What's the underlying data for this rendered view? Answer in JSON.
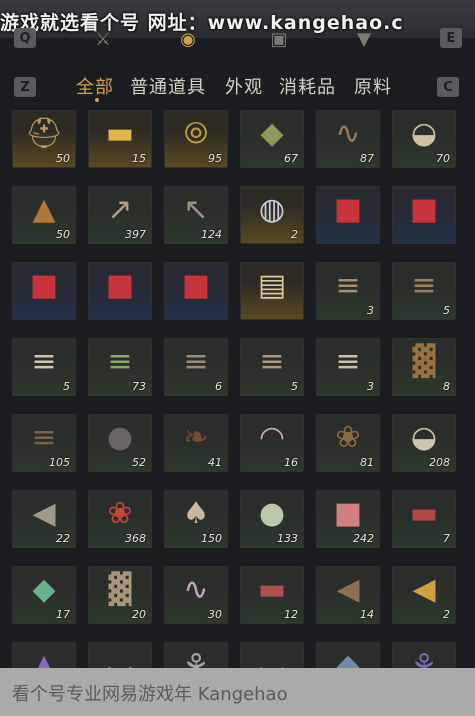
{
  "watermark": {
    "top": "游戏就选看个号   网址：www.kangehao.c",
    "bottom": "看个号专业网易游戏年 Kangehao"
  },
  "keys": {
    "q": "Q",
    "e": "E",
    "z": "Z",
    "c": "C"
  },
  "top_icons": [
    {
      "name": "crossed-swords-icon",
      "glyph": "⚔",
      "active": false
    },
    {
      "name": "pouch-icon",
      "glyph": "◉",
      "active": true
    },
    {
      "name": "box-icon",
      "glyph": "▣",
      "active": false
    },
    {
      "name": "chevrons-down-icon",
      "glyph": "▼",
      "active": false
    }
  ],
  "tabs": [
    {
      "label": "全部",
      "active": true
    },
    {
      "label": "普通道具",
      "active": false
    },
    {
      "label": "外观",
      "active": false
    },
    {
      "label": "消耗品",
      "active": false
    },
    {
      "label": "原料",
      "active": false
    }
  ],
  "items": [
    {
      "name": "helmet-item",
      "icon": "⛑",
      "qty": "50",
      "bg": "gold",
      "color": "#b89a5a"
    },
    {
      "name": "gold-ingot-item",
      "icon": "▬",
      "qty": "15",
      "bg": "gold",
      "color": "#e0b54a"
    },
    {
      "name": "coin-item",
      "icon": "⦾",
      "qty": "95",
      "bg": "gold",
      "color": "#c59a3c"
    },
    {
      "name": "herb-powder-item",
      "icon": "◆",
      "qty": "67",
      "bg": "green",
      "color": "#8a9c5a"
    },
    {
      "name": "worm-item",
      "icon": "∿",
      "qty": "87",
      "bg": "green",
      "color": "#9a7a5a"
    },
    {
      "name": "sack-item",
      "icon": "◒",
      "qty": "70",
      "bg": "green",
      "color": "#cfc2a4"
    },
    {
      "name": "spice-pile-item",
      "icon": "▲",
      "qty": "50",
      "bg": "green",
      "color": "#b0783c"
    },
    {
      "name": "arrows-item",
      "icon": "↗",
      "qty": "397",
      "bg": "green",
      "color": "#b0a08a"
    },
    {
      "name": "arrow-bundle-item",
      "icon": "↖",
      "qty": "124",
      "bg": "green",
      "color": "#a0907a"
    },
    {
      "name": "pearl-ball-item",
      "icon": "◍",
      "qty": "2",
      "bg": "gold",
      "color": "#c8cde0"
    },
    {
      "name": "red-envelope-item",
      "icon": "■",
      "qty": "",
      "bg": "blue",
      "color": "#c8343c"
    },
    {
      "name": "red-envelope-item",
      "icon": "■",
      "qty": "",
      "bg": "blue",
      "color": "#c8343c"
    },
    {
      "name": "red-envelope-item",
      "icon": "■",
      "qty": "",
      "bg": "blue",
      "color": "#c8343c"
    },
    {
      "name": "red-envelope-item",
      "icon": "■",
      "qty": "",
      "bg": "blue",
      "color": "#c8343c"
    },
    {
      "name": "red-envelope-item",
      "icon": "■",
      "qty": "",
      "bg": "blue",
      "color": "#c8343c"
    },
    {
      "name": "scroll-item",
      "icon": "▤",
      "qty": "",
      "bg": "gold",
      "color": "#d8c9a0"
    },
    {
      "name": "logs-item",
      "icon": "≡",
      "qty": "3",
      "bg": "green",
      "color": "#a89070"
    },
    {
      "name": "logs-item",
      "icon": "≡",
      "qty": "5",
      "bg": "green",
      "color": "#a0825a"
    },
    {
      "name": "birch-logs-item",
      "icon": "≡",
      "qty": "5",
      "bg": "green",
      "color": "#cfc4ae"
    },
    {
      "name": "bamboo-item",
      "icon": "≡",
      "qty": "73",
      "bg": "green",
      "color": "#8aa66a"
    },
    {
      "name": "logs-item",
      "icon": "≡",
      "qty": "6",
      "bg": "green",
      "color": "#9a8c78"
    },
    {
      "name": "logs-item",
      "icon": "≡",
      "qty": "5",
      "bg": "green",
      "color": "#b09a7c"
    },
    {
      "name": "birch-logs-item",
      "icon": "≡",
      "qty": "3",
      "bg": "green",
      "color": "#c9c0ae"
    },
    {
      "name": "fur-item",
      "icon": "▓",
      "qty": "8",
      "bg": "green",
      "color": "#9a7040"
    },
    {
      "name": "firewood-item",
      "icon": "≡",
      "qty": "105",
      "bg": "green",
      "color": "#7a6450"
    },
    {
      "name": "stone-item",
      "icon": "●",
      "qty": "52",
      "bg": "green",
      "color": "#6a6562"
    },
    {
      "name": "feather-item",
      "icon": "❧",
      "qty": "41",
      "bg": "green",
      "color": "#7a4a36"
    },
    {
      "name": "shells-item",
      "icon": "◠",
      "qty": "16",
      "bg": "green",
      "color": "#c8b49a"
    },
    {
      "name": "shrimp-item",
      "icon": "❀",
      "qty": "81",
      "bg": "green",
      "color": "#8a6a40"
    },
    {
      "name": "rice-sack-item",
      "icon": "◒",
      "qty": "208",
      "bg": "green",
      "color": "#cfc4ae"
    },
    {
      "name": "fish-item",
      "icon": "◀",
      "qty": "22",
      "bg": "green",
      "color": "#a09a8a"
    },
    {
      "name": "berries-item",
      "icon": "❀",
      "qty": "368",
      "bg": "green",
      "color": "#c04a38"
    },
    {
      "name": "mushrooms-item",
      "icon": "♠",
      "qty": "150",
      "bg": "green",
      "color": "#c8b8a0"
    },
    {
      "name": "eggs-item",
      "icon": "●",
      "qty": "133",
      "bg": "green",
      "color": "#b8c8a8"
    },
    {
      "name": "meat-chunks-item",
      "icon": "■",
      "qty": "242",
      "bg": "green",
      "color": "#d08080"
    },
    {
      "name": "steak-item",
      "icon": "▬",
      "qty": "7",
      "bg": "green",
      "color": "#b04848"
    },
    {
      "name": "jade-stone-item",
      "icon": "◆",
      "qty": "17",
      "bg": "green",
      "color": "#6ab08a"
    },
    {
      "name": "hide-item",
      "icon": "▓",
      "qty": "20",
      "bg": "green",
      "color": "#a8947a"
    },
    {
      "name": "tentacle-item",
      "icon": "∿",
      "qty": "30",
      "bg": "green",
      "color": "#c8a8c0"
    },
    {
      "name": "raw-meat-item",
      "icon": "▬",
      "qty": "12",
      "bg": "green",
      "color": "#b05050"
    },
    {
      "name": "catfish-item",
      "icon": "◀",
      "qty": "14",
      "bg": "green",
      "color": "#8a7050"
    },
    {
      "name": "goldfish-item",
      "icon": "◀",
      "qty": "2",
      "bg": "green",
      "color": "#d0a040"
    },
    {
      "name": "crystal-item",
      "icon": "▲",
      "qty": "",
      "bg": "green",
      "color": "#8a6ac0"
    },
    {
      "name": "bowl-item",
      "icon": "◡",
      "qty": "",
      "bg": "green",
      "color": "#d8d0c0"
    },
    {
      "name": "herb-sprig-item",
      "icon": "⚘",
      "qty": "",
      "bg": "green",
      "color": "#a0a8a0"
    },
    {
      "name": "mortar-item",
      "icon": "◡",
      "qty": "",
      "bg": "green",
      "color": "#8a7a60"
    },
    {
      "name": "ore-item",
      "icon": "◆",
      "qty": "",
      "bg": "green",
      "color": "#7088a8"
    },
    {
      "name": "flower-item",
      "icon": "⚘",
      "qty": "",
      "bg": "green",
      "color": "#7a6aa8"
    }
  ]
}
